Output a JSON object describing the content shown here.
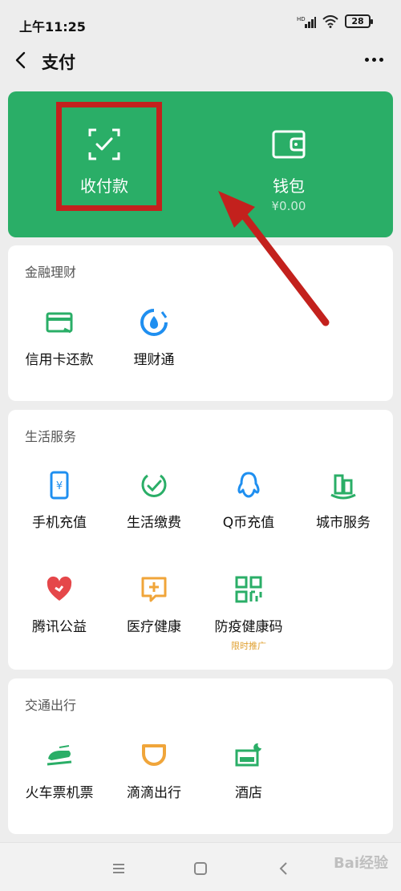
{
  "status_bar": {
    "time": "上午11:25",
    "hd_label": "HD",
    "battery": "28"
  },
  "nav": {
    "title": "支付"
  },
  "top_card": {
    "pay_label": "收付款",
    "wallet_label": "钱包",
    "wallet_balance": "¥0.00",
    "background_color": "#2aae67"
  },
  "sections": [
    {
      "title": "金融理财",
      "items": [
        {
          "label": "信用卡还款",
          "icon": "credit-card-icon"
        },
        {
          "label": "理财通",
          "icon": "wealth-icon"
        }
      ]
    },
    {
      "title": "生活服务",
      "items": [
        {
          "label": "手机充值",
          "icon": "phone-topup-icon"
        },
        {
          "label": "生活缴费",
          "icon": "utility-bill-icon"
        },
        {
          "label": "Q币充值",
          "icon": "qq-coin-icon"
        },
        {
          "label": "城市服务",
          "icon": "city-service-icon"
        },
        {
          "label": "腾讯公益",
          "icon": "charity-heart-icon"
        },
        {
          "label": "医疗健康",
          "icon": "medical-icon"
        },
        {
          "label": "防疫健康码",
          "icon": "health-code-icon",
          "sub": "限时推广"
        }
      ]
    },
    {
      "title": "交通出行",
      "items": [
        {
          "label": "火车票机票",
          "icon": "train-icon"
        },
        {
          "label": "滴滴出行",
          "icon": "didi-icon"
        },
        {
          "label": "酒店",
          "icon": "hotel-icon"
        }
      ]
    }
  ],
  "watermark": "Bai经验",
  "colors": {
    "green": "#2aae67",
    "blue": "#1f8ff0",
    "red": "#e5474a",
    "orange": "#f0a53a",
    "highlight": "#c3211d"
  }
}
